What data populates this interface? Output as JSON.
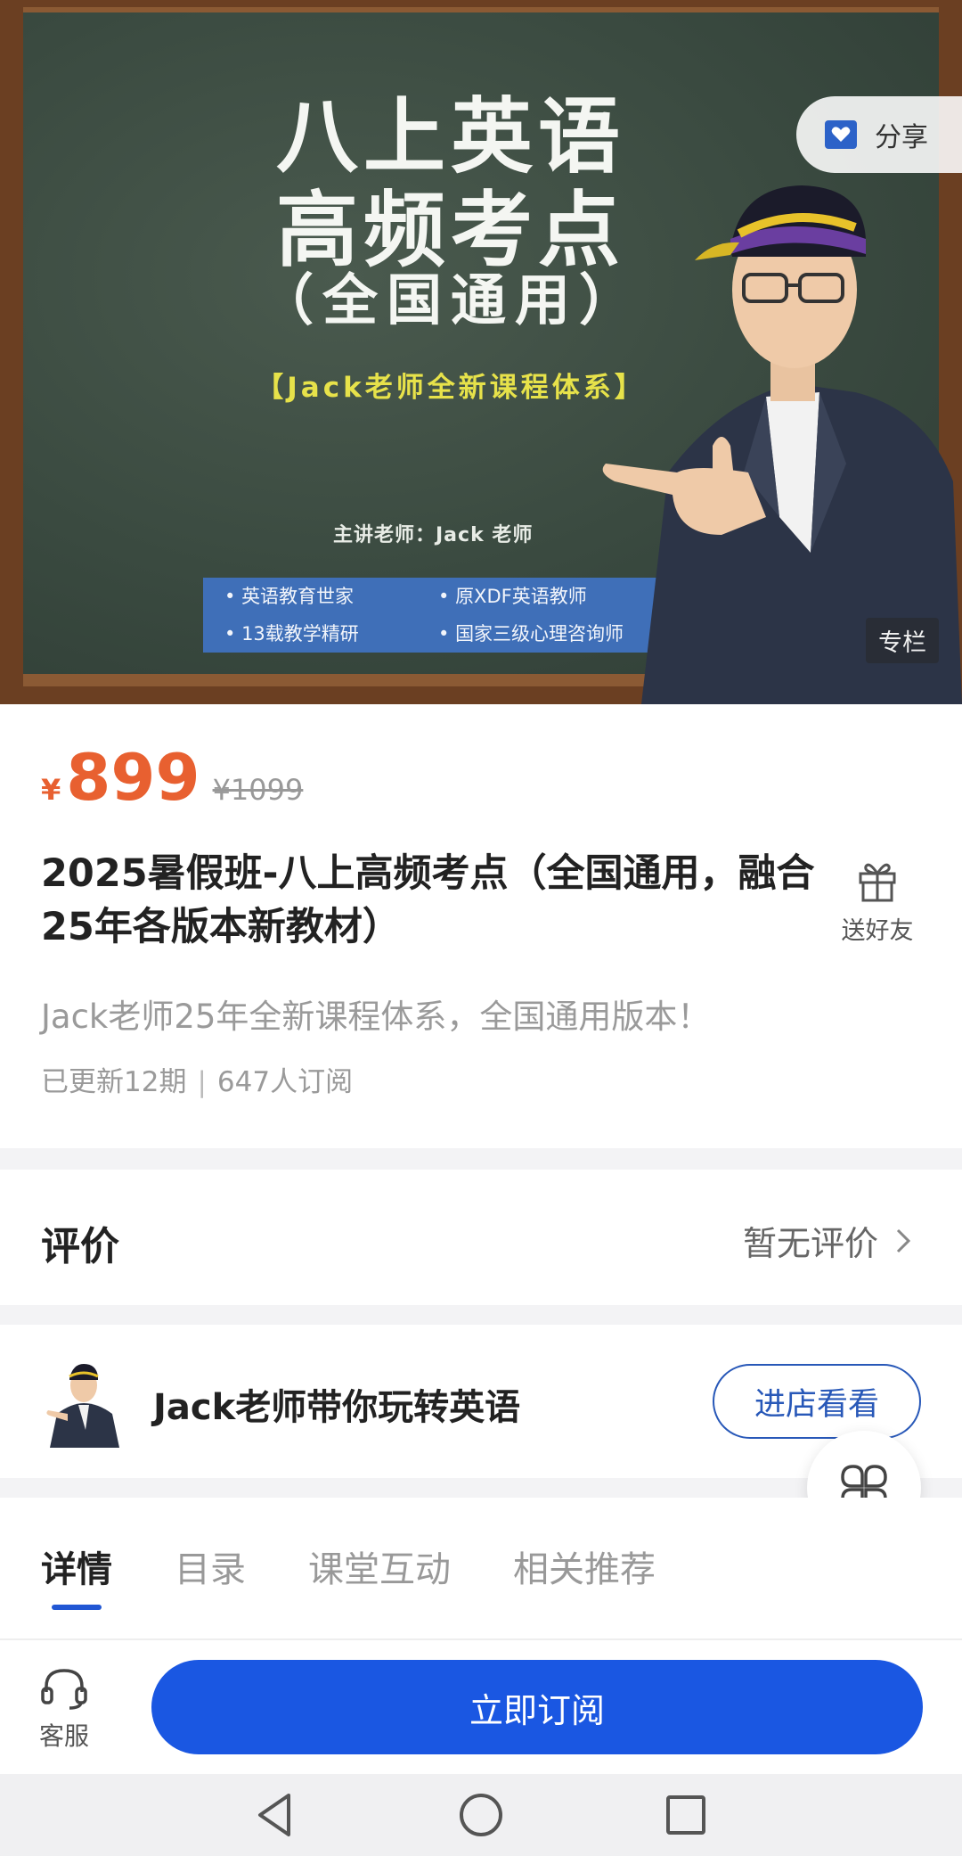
{
  "hero": {
    "title_line1": "八上英语",
    "title_line2": "高频考点",
    "title_line3": "（全国通用）",
    "subtitle": "【Jack老师全新课程体系】",
    "teacher": "主讲老师：Jack 老师",
    "tags": [
      "英语教育世家",
      "原XDF英语教师",
      "13载教学精研",
      "国家三级心理咨询师"
    ],
    "badge": "专栏",
    "share_label": "分享"
  },
  "product": {
    "currency": "¥",
    "price": "899",
    "original_price": "¥1099",
    "title": "2025暑假班-八上高频考点（全国通用，融合25年各版本新教材）",
    "gift_label": "送好友",
    "description": "Jack老师25年全新课程体系，全国通用版本！",
    "updates": "已更新12期",
    "subscribers": "647人订阅"
  },
  "review": {
    "heading": "评价",
    "status": "暂无评价"
  },
  "shop": {
    "name": "Jack老师带你玩转英语",
    "visit_label": "进店看看"
  },
  "tabs": [
    "详情",
    "目录",
    "课堂互动",
    "相关推荐"
  ],
  "bottom_bar": {
    "service_label": "客服",
    "subscribe_label": "立即订阅"
  },
  "colors": {
    "price": "#e86030",
    "primary": "#1a57e2",
    "tab_indicator": "#2157d4"
  }
}
